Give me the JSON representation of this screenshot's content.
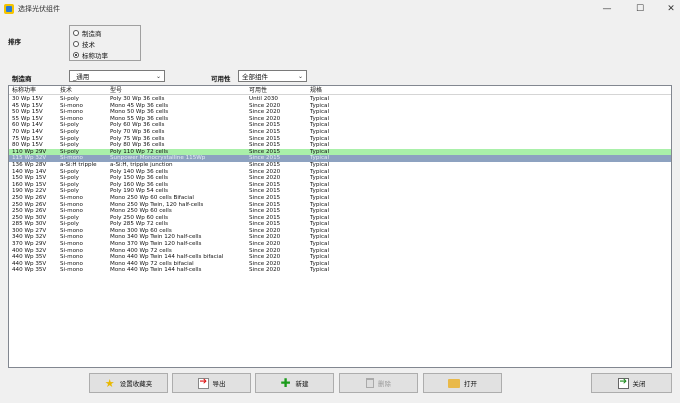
{
  "window": {
    "title": "选择光伏组件"
  },
  "sort": {
    "label": "排序",
    "options": [
      {
        "label": "制造商",
        "selected": false
      },
      {
        "label": "技术",
        "selected": false
      },
      {
        "label": "标称功率",
        "selected": true
      }
    ]
  },
  "filters": {
    "manufacturer_label": "制造商",
    "manufacturer_value": "_通用",
    "availability_label": "可用性",
    "availability_value": "全部组件"
  },
  "table": {
    "headers": [
      "标称功率",
      "技术",
      "型号",
      "可用性",
      "规格"
    ],
    "rows": [
      [
        "30 Wp 15V",
        "Si-poly",
        "Poly 30 Wp 36 cells",
        "Until 2030",
        "Typical"
      ],
      [
        "45 Wp 15V",
        "Si-mono",
        "Mono 45 Wp 36 cells",
        "Since 2020",
        "Typical"
      ],
      [
        "50 Wp 15V",
        "Si-mono",
        "Mono 50 Wp 36 cells",
        "Since 2020",
        "Typical"
      ],
      [
        "55 Wp 15V",
        "Si-mono",
        "Mono 55 Wp 36 cells",
        "Since 2020",
        "Typical"
      ],
      [
        "60 Wp 14V",
        "Si-poly",
        "Poly 60 Wp  36 cells",
        "Since 2015",
        "Typical"
      ],
      [
        "70 Wp 14V",
        "Si-poly",
        "Poly 70 Wp 36 cells",
        "Since 2015",
        "Typical"
      ],
      [
        "75 Wp 15V",
        "Si-poly",
        "Poly 75 Wp 36 cells",
        "Since 2015",
        "Typical"
      ],
      [
        "80 Wp 15V",
        "Si-poly",
        "Poly 80 Wp 36 cells",
        "Since 2015",
        "Typical"
      ],
      [
        "110 Wp 29V",
        "Si-poly",
        "Poly 110 Wp  72 cells",
        "Since 2015",
        "Typical"
      ],
      [
        "115 Wp 32V",
        "Si-mono",
        "Sunpower Monocrystalline 115Wp",
        "Since 2015",
        "Typical"
      ],
      [
        "136 Wp 28V",
        "a-Si:H tripple",
        "a-Si:H, tripple junction",
        "Since 2015",
        "Typical"
      ],
      [
        "140 Wp 14V",
        "Si-poly",
        "Poly 140 Wp 36 cells",
        "Since 2020",
        "Typical"
      ],
      [
        "150 Wp 15V",
        "Si-poly",
        "Poly 150 Wp 36 cells",
        "Since 2020",
        "Typical"
      ],
      [
        "160 Wp 15V",
        "Si-poly",
        "Poly 160 Wp 36 cells",
        "Since 2015",
        "Typical"
      ],
      [
        "190 Wp 22V",
        "Si-poly",
        "Poly 190 Wp  54 cells",
        "Since 2015",
        "Typical"
      ],
      [
        "250 Wp 26V",
        "Si-mono",
        "Mono 250 Wp  60 cells Bifacial",
        "Since 2015",
        "Typical"
      ],
      [
        "250 Wp 26V",
        "Si-mono",
        "Mono 250 Wp  Twin, 120 half-cells",
        "Since 2015",
        "Typical"
      ],
      [
        "250 Wp 26V",
        "Si-mono",
        "Mono 250 Wp  60 cells",
        "Since 2015",
        "Typical"
      ],
      [
        "250 Wp 30V",
        "Si-poly",
        "Poly 250 Wp  60 cells",
        "Since 2015",
        "Typical"
      ],
      [
        "285 Wp 30V",
        "Si-poly",
        "Poly 285 Wp  72 cells",
        "Since 2015",
        "Typical"
      ],
      [
        "300 Wp 27V",
        "Si-mono",
        "Mono 300 Wp 60 cells",
        "Since 2020",
        "Typical"
      ],
      [
        "340 Wp 32V",
        "Si-mono",
        "Mono 340 Wp Twin 120 half-cells",
        "Since 2020",
        "Typical"
      ],
      [
        "370 Wp 29V",
        "Si-mono",
        "Mono 370 Wp Twin 120 half-cells",
        "Since 2020",
        "Typical"
      ],
      [
        "400 Wp 32V",
        "Si-mono",
        "Mono 400 Wp 72 cells",
        "Since 2020",
        "Typical"
      ],
      [
        "440 Wp 35V",
        "Si-mono",
        "Mono 440 Wp Twin 144 half-cells bifacial",
        "Since 2020",
        "Typical"
      ],
      [
        "440 Wp 35V",
        "Si-mono",
        "Mono 440 Wp 72 cells bifacial",
        "Since 2020",
        "Typical"
      ],
      [
        "440 Wp 35V",
        "Si-mono",
        "Mono 440 Wp Twin 144 half-cells",
        "Since 2020",
        "Typical"
      ]
    ],
    "selected_row": 8,
    "highlight_row": 9
  },
  "buttons": {
    "favorites": "设置收藏夹",
    "export": "导出",
    "new": "新建",
    "delete": "删除",
    "open": "打开",
    "close": "关闭"
  },
  "colors": {
    "selected_row": "#a9f0a9",
    "highlight_row": "#8da2c0"
  }
}
